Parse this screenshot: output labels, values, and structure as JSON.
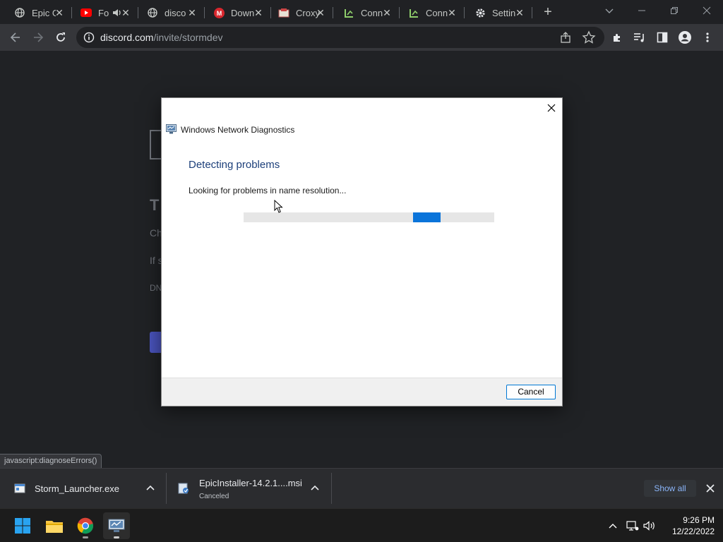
{
  "browser": {
    "tabs": [
      {
        "title": "Epic G",
        "icon": "globe-icon"
      },
      {
        "title": "Fo",
        "icon": "youtube-icon",
        "audio": true
      },
      {
        "title": "disco",
        "icon": "globe-icon"
      },
      {
        "title": "Down",
        "icon": "mega-icon"
      },
      {
        "title": "Croxy",
        "icon": "croxy-icon"
      },
      {
        "title": "Conn",
        "icon": "cpanel-icon"
      },
      {
        "title": "Conn",
        "icon": "cpanel-icon"
      },
      {
        "title": "Settin",
        "icon": "gear-icon"
      }
    ],
    "url_domain": "discord.com",
    "url_path": "/invite/stormdev",
    "status_url": "javascript:diagnoseErrors()"
  },
  "page": {
    "title": "T",
    "line1": "Ch",
    "line2": "If s",
    "line3": "DN"
  },
  "dialog": {
    "window_title": "Windows Network Diagnostics",
    "heading": "Detecting problems",
    "status": "Looking for problems in name resolution...",
    "cancel_label": "Cancel",
    "heading_color": "#1c3f7a",
    "progress_color": "#0a74da"
  },
  "downloads": {
    "items": [
      {
        "name": "Storm_Launcher.exe",
        "status": ""
      },
      {
        "name": "EpicInstaller-14.2.1....msi",
        "status": "Canceled"
      }
    ],
    "show_all_label": "Show all"
  },
  "taskbar": {
    "apps": [
      "start-icon",
      "file-explorer-icon",
      "chrome-icon",
      "network-diagnostics-icon"
    ],
    "time": "9:26 PM",
    "date": "12/22/2022"
  }
}
